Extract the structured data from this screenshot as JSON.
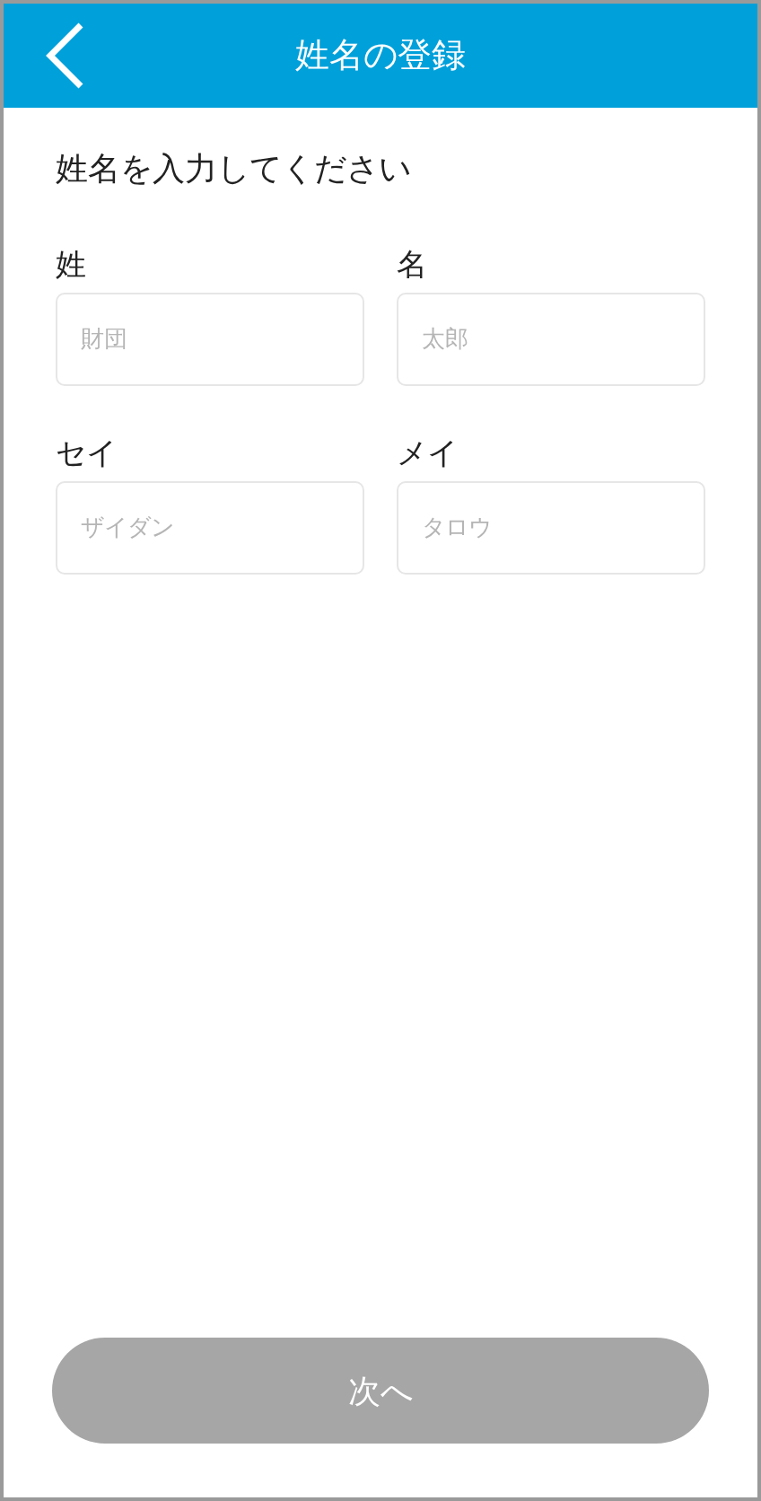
{
  "header": {
    "title": "姓名の登録"
  },
  "instruction": "姓名を入力してください",
  "fields": [
    {
      "label": "姓",
      "placeholder": "財団"
    },
    {
      "label": "名",
      "placeholder": "太郎"
    },
    {
      "label": "セイ",
      "placeholder": "ザイダン"
    },
    {
      "label": "メイ",
      "placeholder": "タロウ"
    }
  ],
  "next_button": {
    "label": "次へ",
    "disabled": true
  }
}
